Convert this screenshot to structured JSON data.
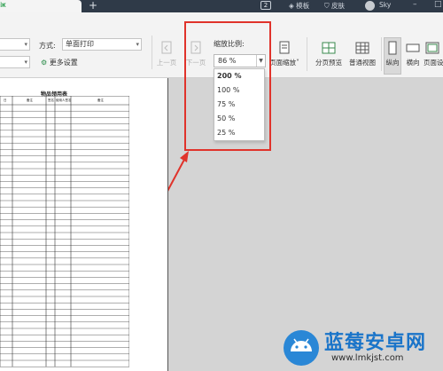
{
  "titlebar": {
    "tab_text": "ix",
    "tab_close": "×",
    "new_tab": "+",
    "badge": "2",
    "template_label": "模板",
    "skin_label": "皮肤",
    "user_name": "Sky",
    "minimize": "–",
    "maximize": "□"
  },
  "toolbar": {
    "method_label": "方式:",
    "method_value": "单面打印",
    "more_settings": "更多设置",
    "prev_page": "上一页",
    "next_page": "下一页",
    "zoom_title": "缩放比例:",
    "zoom_value": "86 %",
    "zoom_options": [
      "200 %",
      "100 %",
      "75 %",
      "50 %",
      "25 %"
    ],
    "page_zoom": "页面缩放",
    "page_preview": "分页预览",
    "normal_view": "普通视图",
    "portrait": "纵向",
    "landscape": "横向",
    "page_setup": "页面设"
  },
  "document": {
    "sheet_title": "物品领用表",
    "headers": [
      "日",
      "备注",
      "签名",
      "使用人签名",
      "备注"
    ]
  },
  "watermark": {
    "brand": "蓝莓安卓网",
    "url": "www.lmkjst.com"
  },
  "colors": {
    "highlight": "#e0332b",
    "brand_blue": "#1a74c9",
    "titlebar": "#2f3a48"
  }
}
